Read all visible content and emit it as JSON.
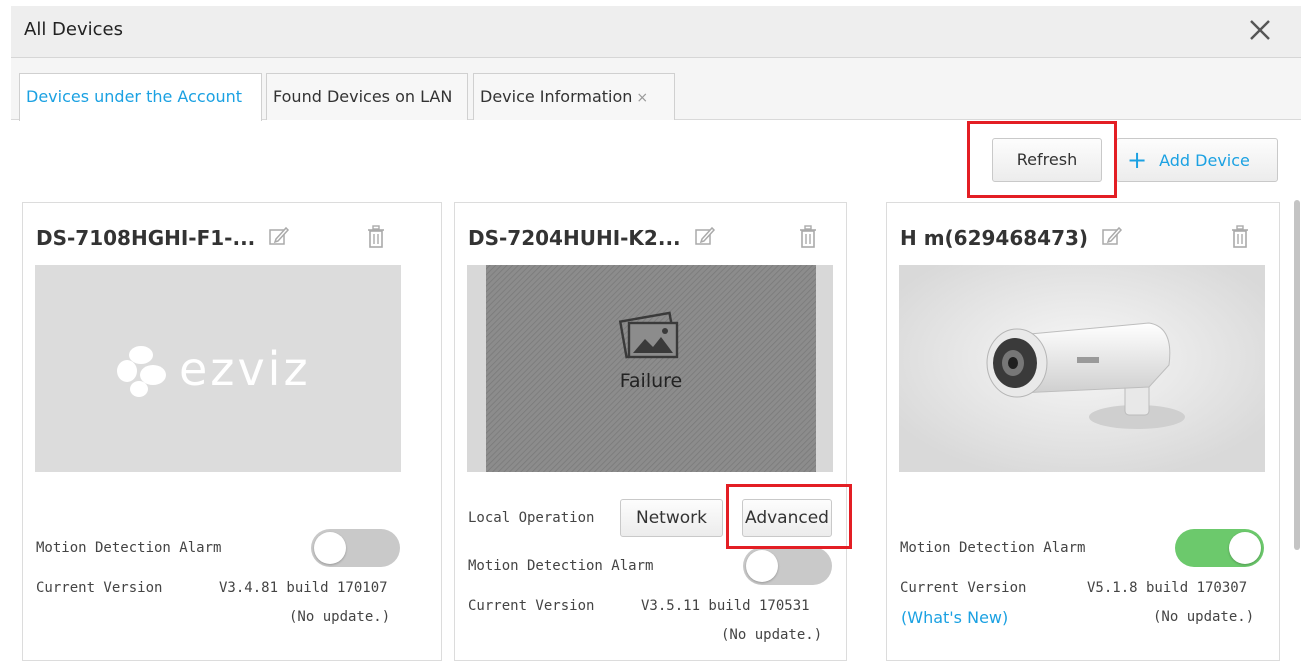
{
  "window": {
    "title": "All Devices"
  },
  "tabs": [
    {
      "label": "Devices under the Account"
    },
    {
      "label": "Found Devices on LAN"
    },
    {
      "label": "Device Information",
      "close": "×"
    }
  ],
  "toolbar": {
    "refresh_label": "Refresh",
    "add_icon": "+",
    "add_label": "Add Device"
  },
  "colors": {
    "accent": "#1ba1e2",
    "highlight": "#e31e24",
    "toggle_on": "#6cc96c",
    "toggle_off": "#c9c9c9"
  },
  "devices": [
    {
      "name": "DS-7108HGHI-F1-...",
      "thumbnail": "ezviz-logo",
      "logo_text": "ezviz",
      "motion_label": "Motion Detection Alarm",
      "motion_on": false,
      "version_label": "Current Version",
      "version_value": "V3.4.81 build 170107",
      "update_status": "(No update.)"
    },
    {
      "name": "DS-7204HUHI-K2...",
      "thumbnail": "failure-image",
      "failure_text": "Failure",
      "local_op_label": "Local Operation",
      "network_label": "Network",
      "advanced_label": "Advanced",
      "motion_label": "Motion Detection Alarm",
      "motion_on": false,
      "version_label": "Current Version",
      "version_value": "V3.5.11 build 170531",
      "update_status": "(No update.)"
    },
    {
      "name": "H m(629468473)",
      "thumbnail": "camera-image",
      "motion_label": "Motion Detection Alarm",
      "motion_on": true,
      "version_label": "Current Version",
      "version_value": "V5.1.8 build 170307",
      "whats_new": "(What's New)",
      "update_status": "(No update.)"
    }
  ]
}
